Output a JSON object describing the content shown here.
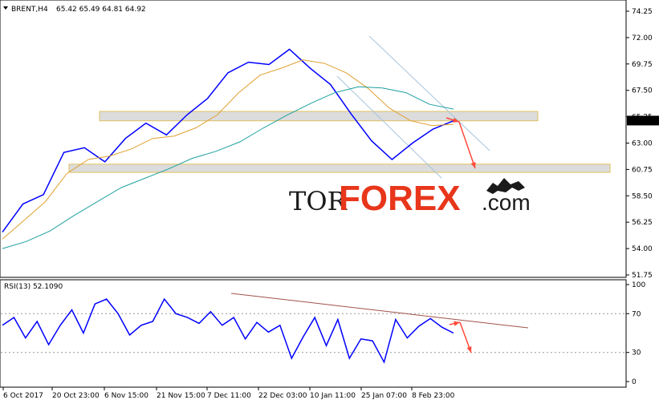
{
  "header": {
    "symbol": "BRENT,H4",
    "ohlc": "65.42 65.49 64.81 64.92",
    "menu_icon": "triangle-down-icon"
  },
  "rsi_header": "RSI(13) 52.1090",
  "watermark": {
    "part1": "TOR",
    "part2": "FOREX",
    "part3": ".com",
    "colors": {
      "tor": "#1a1a1a",
      "forex": "#e8361b",
      "com": "#1a1a1a"
    },
    "logo_icon": "bull-bear-icon"
  },
  "chart_data": [
    {
      "type": "line",
      "panel": "price",
      "x": [
        "6 Oct 2017",
        "20 Oct 23:00",
        "6 Nov 15:00",
        "21 Nov 15:00",
        "7 Dec 11:00",
        "22 Dec 03:00",
        "10 Jan 11:00",
        "25 Jan 07:00",
        "8 Feb 23:00"
      ],
      "ylim": [
        51.75,
        74.25
      ],
      "yticks": [
        "74.25",
        "72.00",
        "69.75",
        "67.50",
        "65.25",
        "63.00",
        "60.75",
        "58.50",
        "56.25",
        "54.00",
        "51.75"
      ],
      "current_price": "64.92",
      "series": [
        {
          "values": [
            55.4,
            57.8,
            58.6,
            62.2,
            62.6,
            61.4,
            63.4,
            64.7,
            63.7,
            65.4,
            66.8,
            69.0,
            69.9,
            69.7,
            71.0,
            69.4,
            68.0,
            65.5,
            63.2,
            61.6,
            63.0,
            64.2,
            64.9
          ]
        },
        {
          "values": [
            54.8,
            56.4,
            58.0,
            60.4,
            61.6,
            61.9,
            62.5,
            63.4,
            63.6,
            64.3,
            65.4,
            67.3,
            68.8,
            69.4,
            70.1,
            69.8,
            69.0,
            67.7,
            66.0,
            64.9,
            64.5,
            64.6
          ]
        },
        {
          "values": [
            54.0,
            54.6,
            55.5,
            56.8,
            58.0,
            59.2,
            60.0,
            60.8,
            61.7,
            62.3,
            63.1,
            64.3,
            65.4,
            66.4,
            67.3,
            67.8,
            67.7,
            67.3,
            66.3,
            65.9
          ]
        }
      ],
      "zones": [
        [
          64.9,
          65.7
        ],
        [
          60.5,
          61.2
        ]
      ],
      "colors": {
        "price": "#0000ff",
        "ma_fast": "#e0a030",
        "ma_slow": "#20a0a0",
        "zone": "#e0c060",
        "arrow": "#ff4a3a",
        "channel": "#a8c4dc"
      }
    },
    {
      "type": "line",
      "panel": "rsi",
      "ylim": [
        0,
        100
      ],
      "yticks": [
        "100",
        "70",
        "30",
        "0"
      ],
      "series": [
        {
          "values": [
            58,
            66,
            45,
            62,
            38,
            58,
            74,
            50,
            80,
            85,
            70,
            48,
            58,
            62,
            85,
            70,
            66,
            60,
            72,
            58,
            66,
            44,
            61,
            51,
            58,
            24,
            46,
            66,
            37,
            64,
            24,
            44,
            42,
            20,
            64,
            45,
            57,
            65,
            56,
            50
          ]
        }
      ]
    }
  ]
}
